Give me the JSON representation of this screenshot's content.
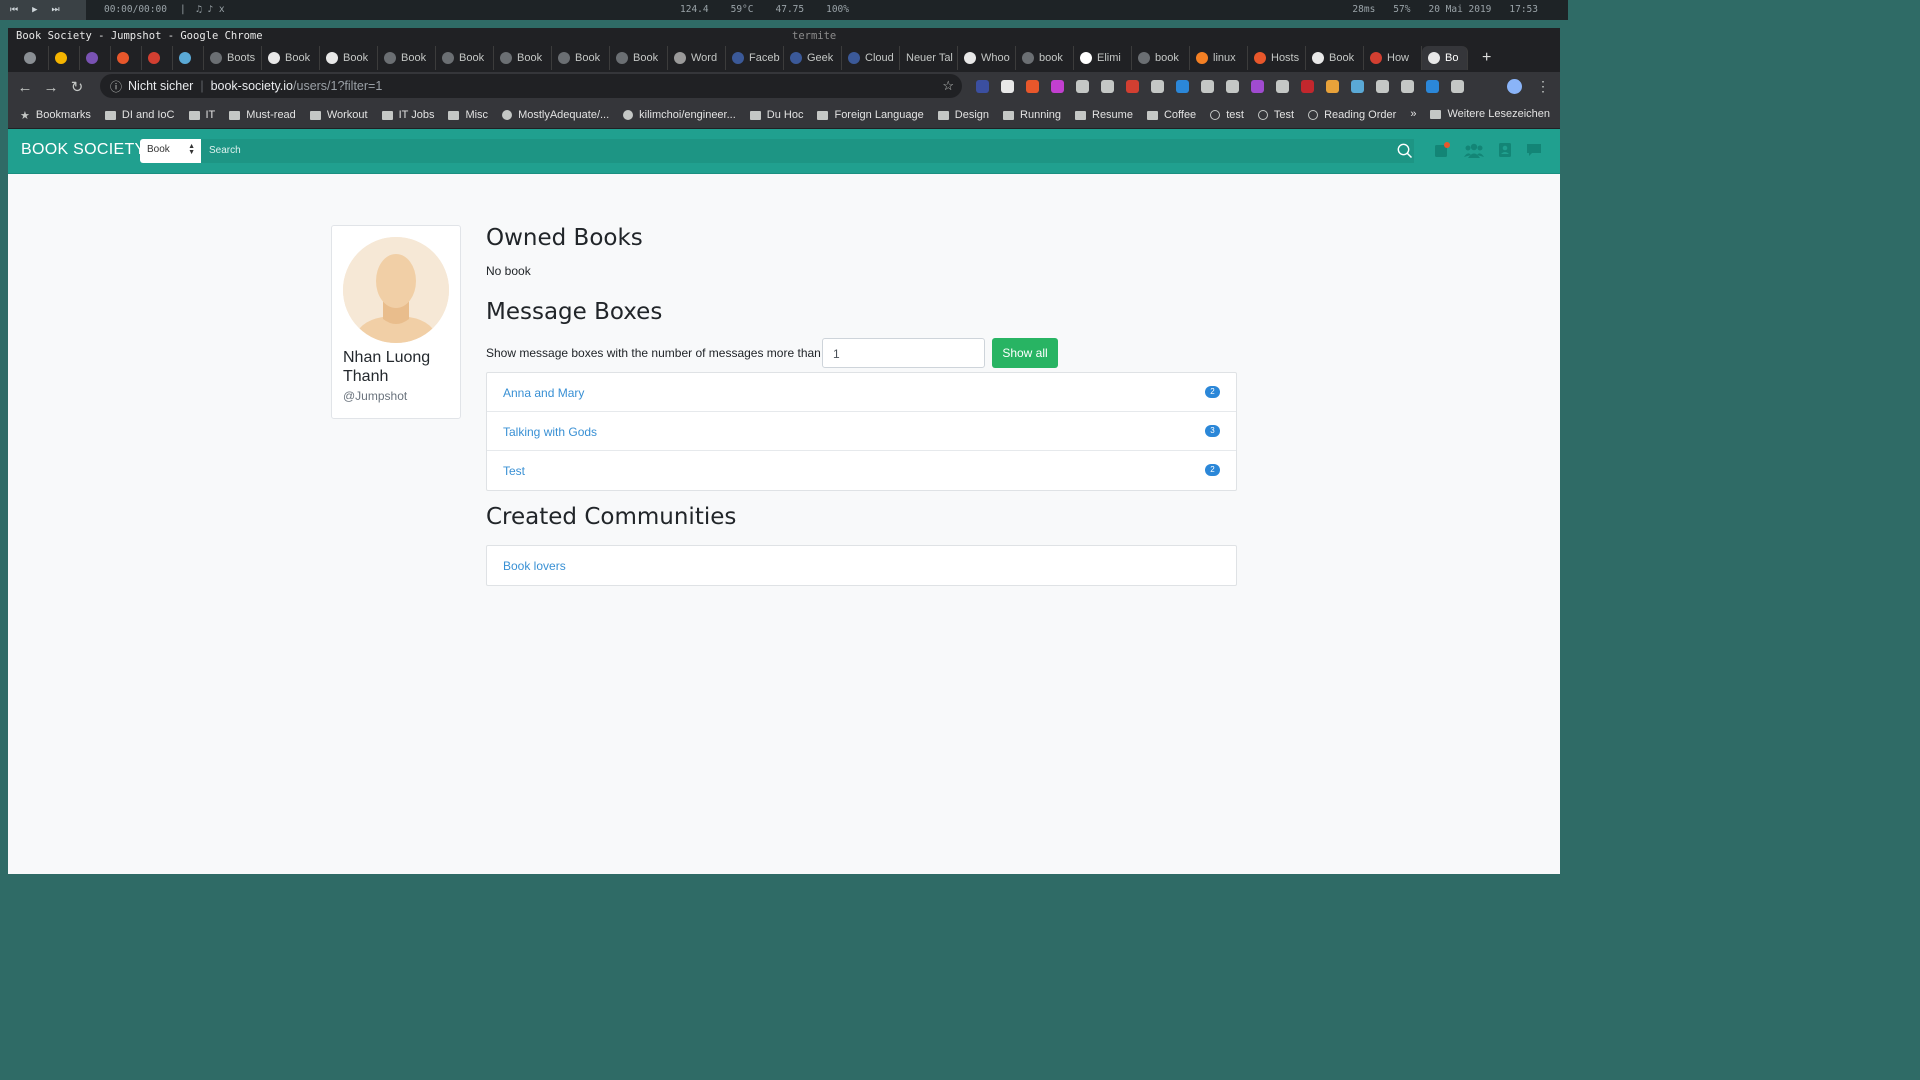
{
  "sysbar": {
    "media_controls": [
      "⏮",
      "▶",
      "⏭"
    ],
    "time": "00:00/00:00",
    "separator": "|",
    "note": "♫ ♪ x",
    "stats": [
      "124.4",
      "59°C",
      "47.75",
      "100%"
    ],
    "right": [
      "28ms",
      "57%",
      "20 Mai 2019",
      "17:53"
    ]
  },
  "window": {
    "title": "Book Society - Jumpshot - Google Chrome",
    "terminal_title": "termite"
  },
  "tabs": [
    {
      "label": "",
      "color": "#8a8f94"
    },
    {
      "label": "",
      "color": "#f4b400"
    },
    {
      "label": "",
      "color": "#7952b3"
    },
    {
      "label": "",
      "color": "#e8572b"
    },
    {
      "label": "",
      "color": "#d23f31"
    },
    {
      "label": "",
      "color": "#5aa9d6"
    },
    {
      "label": "Boots",
      "color": "#6b6f73"
    },
    {
      "label": "Book",
      "color": "#e8e8e8"
    },
    {
      "label": "Book",
      "color": "#e8e8e8"
    },
    {
      "label": "Book",
      "color": "#6b6f73"
    },
    {
      "label": "Book",
      "color": "#6b6f73"
    },
    {
      "label": "Book",
      "color": "#6b6f73"
    },
    {
      "label": "Book",
      "color": "#6b6f73"
    },
    {
      "label": "Book",
      "color": "#6b6f73"
    },
    {
      "label": "Word",
      "color": "#9a9a9a"
    },
    {
      "label": "Faceb",
      "color": "#3b5998"
    },
    {
      "label": "Geek",
      "color": "#3b5998"
    },
    {
      "label": "Cloud",
      "color": "#3b5998"
    },
    {
      "label": "Neuer Tal",
      "color": ""
    },
    {
      "label": "Whoo",
      "color": "#e8e8e8"
    },
    {
      "label": "book",
      "color": "#6b6f73"
    },
    {
      "label": "Elimi",
      "color": "#ffffff"
    },
    {
      "label": "book",
      "color": "#6b6f73"
    },
    {
      "label": "linux",
      "color": "#f48024"
    },
    {
      "label": "Hosts",
      "color": "#e8572b"
    },
    {
      "label": "Book",
      "color": "#e8e8e8"
    },
    {
      "label": "How",
      "color": "#d23f31"
    },
    {
      "label": "Bo",
      "color": "#e8e8e8",
      "active": true
    }
  ],
  "tab_close": "×",
  "new_tab": "+",
  "toolbar": {
    "back": "←",
    "forward": "→",
    "reload": "↻",
    "info_icon": "ⓘ",
    "security": "Nicht sicher",
    "url_host": "book-society.io",
    "url_path": "/users/1?filter=1",
    "star": "☆",
    "menu": "⋮"
  },
  "extensions": [
    "#3b4fa0",
    "#e8e8e8",
    "#e8572b",
    "#c23fd0",
    "#c4c7c5",
    "#c4c7c5",
    "#d23f31",
    "#c4c7c5",
    "#2b87d8",
    "#c4c7c5",
    "#c4c7c5",
    "#a04bd0",
    "#c4c7c5",
    "#c2272d",
    "#e8a23a",
    "#5aa9d6",
    "#c4c7c5",
    "#c4c7c5",
    "#2b87d8",
    "#c4c7c5"
  ],
  "bookmarks": {
    "items": [
      {
        "label": "Bookmarks",
        "icon": "star"
      },
      {
        "label": "DI and IoC",
        "icon": "folder"
      },
      {
        "label": "IT",
        "icon": "folder"
      },
      {
        "label": "Must-read",
        "icon": "folder"
      },
      {
        "label": "Workout",
        "icon": "folder"
      },
      {
        "label": "IT Jobs",
        "icon": "folder"
      },
      {
        "label": "Misc",
        "icon": "folder"
      },
      {
        "label": "MostlyAdequate/...",
        "icon": "github"
      },
      {
        "label": "kilimchoi/engineer...",
        "icon": "github"
      },
      {
        "label": "Du Hoc",
        "icon": "folder"
      },
      {
        "label": "Foreign Language",
        "icon": "folder"
      },
      {
        "label": "Design",
        "icon": "folder"
      },
      {
        "label": "Running",
        "icon": "folder"
      },
      {
        "label": "Resume",
        "icon": "folder"
      },
      {
        "label": "Coffee",
        "icon": "folder"
      },
      {
        "label": "test",
        "icon": "globe"
      },
      {
        "label": "Test",
        "icon": "globe"
      },
      {
        "label": "Reading Order",
        "icon": "globe"
      }
    ],
    "more": "»",
    "other": "Weitere Lesezeichen"
  },
  "app": {
    "brand": "BOOK SOCIETY",
    "search_type": "Book",
    "search_placeholder": "Search",
    "accent": "#20a08f"
  },
  "profile": {
    "name": "Nhan Luong Thanh",
    "username": "@Jumpshot"
  },
  "owned_books": {
    "heading": "Owned Books",
    "empty_text": "No book"
  },
  "message_boxes": {
    "heading": "Message Boxes",
    "filter_label": "Show message boxes with the number of messages more than",
    "filter_value": "1",
    "show_all": "Show all",
    "items": [
      {
        "name": "Anna and Mary",
        "count": "2"
      },
      {
        "name": "Talking with Gods",
        "count": "3"
      },
      {
        "name": "Test",
        "count": "2"
      }
    ]
  },
  "communities": {
    "heading": "Created Communities",
    "items": [
      {
        "name": "Book lovers"
      }
    ]
  }
}
